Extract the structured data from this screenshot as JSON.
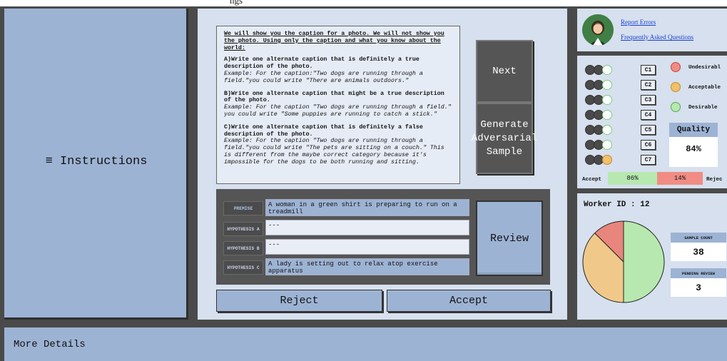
{
  "top_caption": "ngs",
  "left_panel": {
    "icon": "hamburger-icon",
    "label": "Instructions",
    "glyph": "≡"
  },
  "instructions": {
    "intro": "We will show you the caption for a photo. We will not show you the photo. Using only the caption and what you know about the world:",
    "a_head": "A)Write one alternate caption that is definitely a true description of the photo.",
    "a_ex": "Example: For the caption:\"Two dogs are running through a field.\"you could write \"There are animals outdoors.\"",
    "b_head": "B)Write one alternate caption that might be a true description of the photo.",
    "b_ex": "Example: For the caption \"Two dogs are running through a field.\" you could write \"Some puppies are running to catch a stick.\"",
    "c_head": "C)Write one alternate caption that is definitely a false description of the photo.",
    "c_ex": "Example: For the caption \"Two dogs are running through a field.\"you could write \"The pets are sitting on a couch.\" This is different from the maybe correct category because it's impossible for the dogs to be both running and sitting."
  },
  "buttons": {
    "next": "Next",
    "generate": "Generate Adversarial Sample",
    "review": "Review",
    "reject": "Reject",
    "accept": "Accept"
  },
  "form": {
    "premise_label": "PREMISE",
    "premise_value": "A woman in a green shirt is preparing to run on a treadmill",
    "hyp_a_label": "HYPOTHESIS A",
    "hyp_a_value": "---",
    "hyp_b_label": "HYPOTHESIS B",
    "hyp_b_value": "---",
    "hyp_c_label": "HYPOTHESIS C",
    "hyp_c_value": "A lady is setting out to relax atop exercise apparatus"
  },
  "links": {
    "report": "Report Errors",
    "faq": "Frequently Asked Questions"
  },
  "classes": [
    {
      "label": "C1",
      "status": "green"
    },
    {
      "label": "C2",
      "status": "green"
    },
    {
      "label": "C3",
      "status": "green"
    },
    {
      "label": "C4",
      "status": "green"
    },
    {
      "label": "C5",
      "status": "green"
    },
    {
      "label": "C6",
      "status": "green"
    },
    {
      "label": "C7",
      "status": "orange"
    }
  ],
  "legend": {
    "undesirable": "Undesirabl",
    "acceptable": "Acceptable",
    "desirable": "Desirable"
  },
  "quality": {
    "title": "Quality",
    "value": "84%"
  },
  "accept_reject": {
    "accept_label": "Accept",
    "reject_label": "Rejec",
    "accept_pct": "86%",
    "reject_pct": "14%",
    "accept_fraction": 0.86
  },
  "worker": {
    "label": "Worker ID : 12",
    "sample_count_label": "SAMPLE COUNT",
    "sample_count": "38",
    "pending_review_label": "PENDING REVIEW",
    "pending_review": "3"
  },
  "pie": {
    "slices": [
      {
        "name": "desirable",
        "fraction": 0.5,
        "color": "#b7e8b0"
      },
      {
        "name": "acceptable",
        "fraction": 0.375,
        "color": "#f0c98a"
      },
      {
        "name": "undesirable",
        "fraction": 0.125,
        "color": "#e8857c"
      }
    ]
  },
  "bottom": {
    "more_details": "More Details"
  },
  "colors": {
    "panel_blue": "#9db3d4",
    "panel_light": "#d6e0ee",
    "dark_gray": "#555555",
    "green": "#b7e8b0",
    "orange": "#f0c06a",
    "red": "#f08c84"
  }
}
